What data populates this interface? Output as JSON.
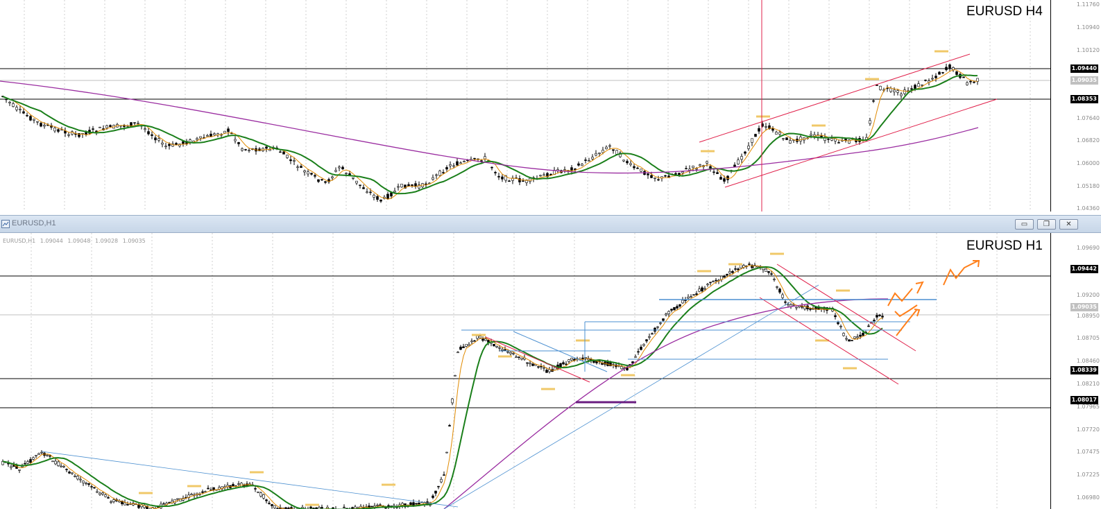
{
  "top_chart": {
    "symbol_label": "EURUSD H4",
    "price_ticks": [
      "1.11760",
      "1.10940",
      "1.10120",
      "1.09035",
      "1.08353",
      "1.07640",
      "1.06820",
      "1.06000",
      "1.05180",
      "1.04360"
    ],
    "price_tags": [
      {
        "value": "1.09440",
        "style": "black"
      },
      {
        "value": "1.09035",
        "style": "grey"
      },
      {
        "value": "1.08353",
        "style": "black"
      }
    ]
  },
  "bottom_window": {
    "title": "EURUSD,H1",
    "ohlc_text": {
      "symbol": "EURUSD,H1",
      "open": "1.09044",
      "high": "1.09048",
      "low": "1.09028",
      "close": "1.09035"
    },
    "symbol_label": "EURUSD H1",
    "buttons": {
      "minimize": "▭",
      "restore": "❐",
      "close": "✕"
    },
    "price_ticks": [
      "1.09690",
      "1.09442",
      "1.09200",
      "1.09035",
      "1.08950",
      "1.08705",
      "1.08460",
      "1.08339",
      "1.08210",
      "1.08017",
      "1.07965",
      "1.07720",
      "1.07475",
      "1.07225",
      "1.06980"
    ],
    "price_tags": [
      {
        "value": "1.09442",
        "style": "black"
      },
      {
        "value": "1.09035",
        "style": "grey"
      },
      {
        "value": "1.08339",
        "style": "black"
      },
      {
        "value": "1.08017",
        "style": "black"
      }
    ]
  },
  "colors": {
    "ema_short": "#e08a00",
    "ema_mid": "#1a7f1a",
    "ema_long": "#9a2ca0",
    "channel": "#e0204a",
    "trend": "#4a8fd0",
    "arrow": "#ff7f1a"
  }
}
